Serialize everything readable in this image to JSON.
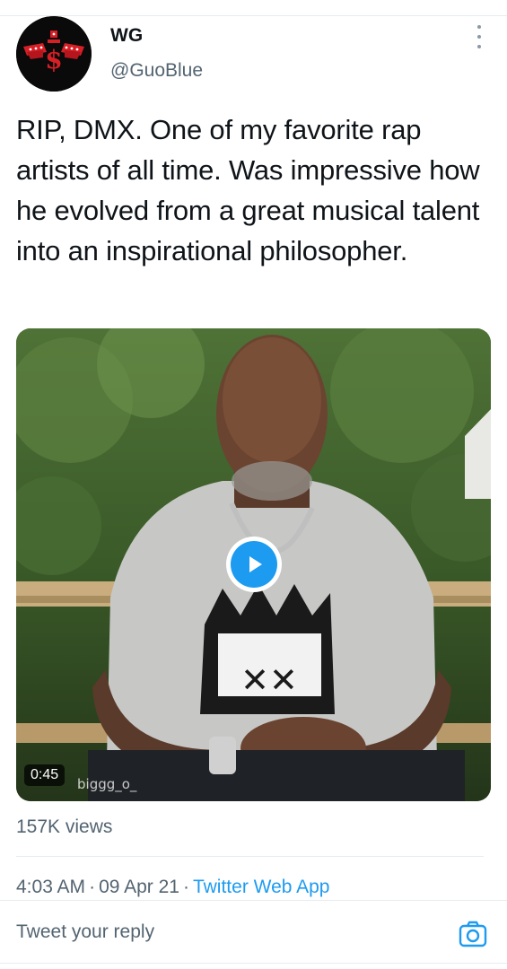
{
  "tweet": {
    "author": {
      "display_name": "WG",
      "handle": "@GuoBlue",
      "avatar_icon": "winged-emblem-avatar"
    },
    "more_icon": "more-vertical-icon",
    "text": "RIP, DMX. One of my favorite rap artists of all time. Was impressive how he evolved from a great musical talent into an inspirational philosopher.",
    "media": {
      "type": "video",
      "duration": "0:45",
      "watermark": "biggg_o_",
      "play_icon": "play-icon"
    },
    "views": "157K views",
    "meta": {
      "time": "4:03 AM",
      "date": "09 Apr 21",
      "separator": "·",
      "source": "Twitter Web App"
    }
  },
  "reply": {
    "placeholder": "Tweet your reply",
    "camera_icon": "camera-icon"
  },
  "colors": {
    "accent": "#1d9bf0",
    "text_primary": "#0f1419",
    "text_secondary": "#536471",
    "divider": "#e6ecf0"
  }
}
